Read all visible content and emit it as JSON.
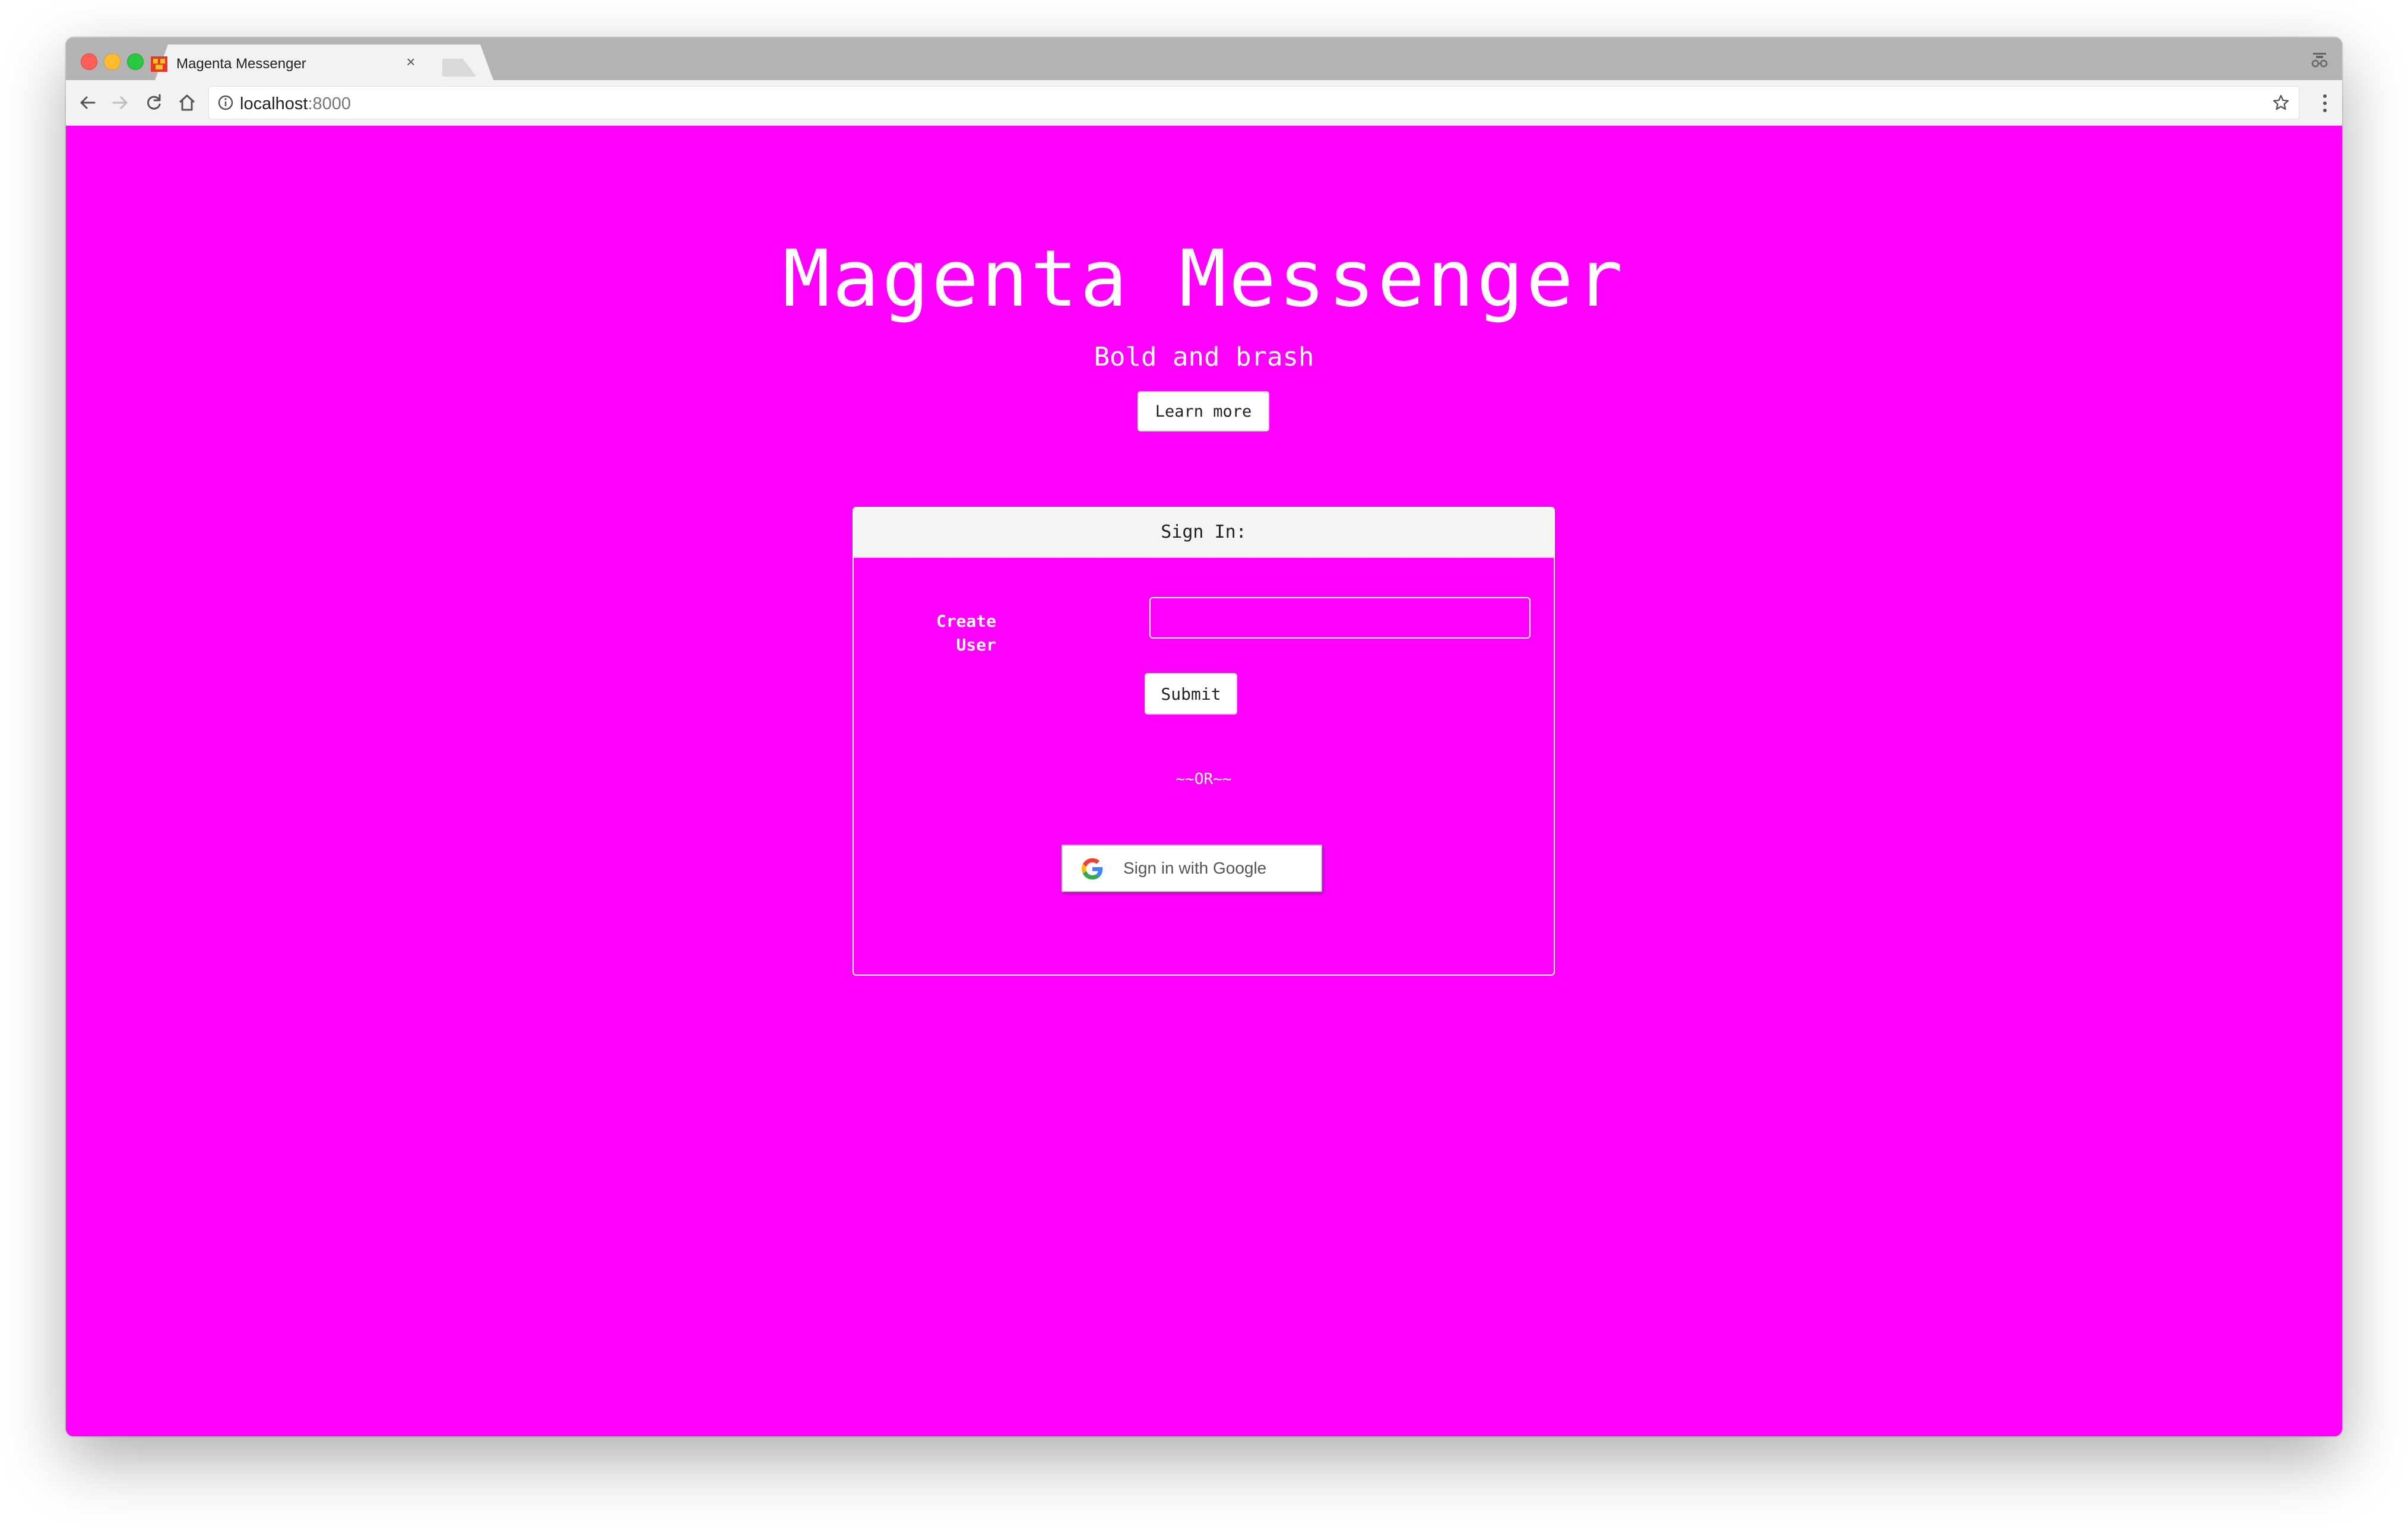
{
  "browser": {
    "tab_title": "Magenta Messenger",
    "tab_close": "×",
    "url_host": "localhost",
    "url_port": ":8000"
  },
  "hero": {
    "title": "Magenta Messenger",
    "subtitle": "Bold and brash",
    "learn_more_label": "Learn more"
  },
  "signin": {
    "header": "Sign In:",
    "create_label_line1": "Create",
    "create_label_line2": "User",
    "username_value": "",
    "submit_label": "Submit",
    "or_text": "~~OR~~",
    "google_label": "Sign in with Google"
  },
  "colors": {
    "page_background": "#ff00ff",
    "chrome_tabstrip": "#b3b3b3",
    "chrome_toolbar": "#f2f2f2"
  }
}
